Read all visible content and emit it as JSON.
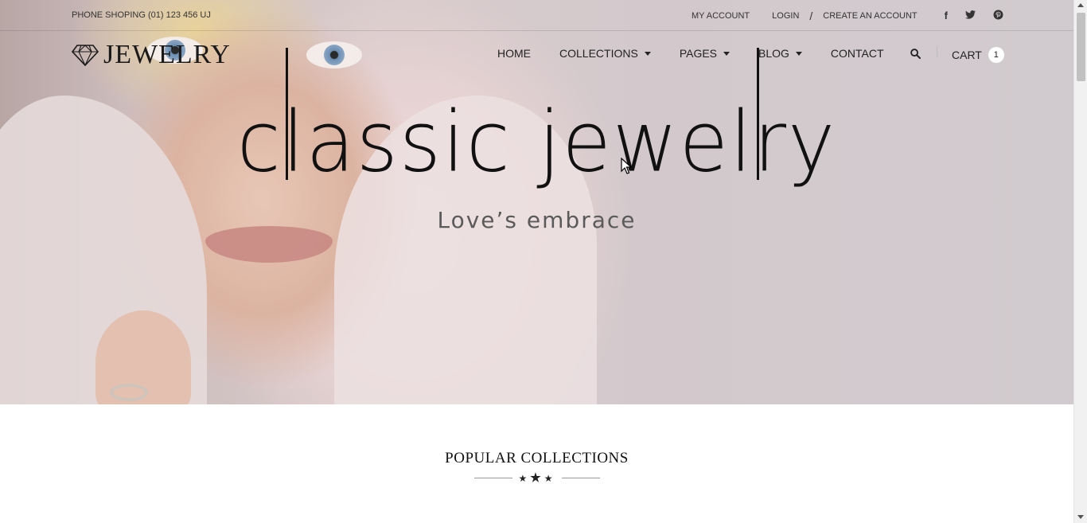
{
  "topbar": {
    "phone": "PHONE SHOPING (01) 123 456 UJ",
    "my_account": "MY ACCOUNT",
    "login": "LOGIN",
    "separator": "/",
    "create_account": "CREATE AN ACCOUNT",
    "social": [
      {
        "icon": "facebook-icon",
        "glyph": "f"
      },
      {
        "icon": "twitter-icon",
        "glyph": "t"
      },
      {
        "icon": "pinterest-icon",
        "glyph": "p"
      }
    ]
  },
  "logo": {
    "text": "JEWELRY",
    "icon": "diamond-icon"
  },
  "nav": {
    "items": [
      {
        "label": "HOME",
        "dropdown": false
      },
      {
        "label": "COLLECTIONS",
        "dropdown": true
      },
      {
        "label": "PAGES",
        "dropdown": true
      },
      {
        "label": "BLOG",
        "dropdown": true
      },
      {
        "label": "CONTACT",
        "dropdown": false
      }
    ],
    "search_icon": "search-icon",
    "cart_label": "CART",
    "cart_count": "1"
  },
  "hero": {
    "headline": "classic jewelry",
    "subhead": "Love’s embrace"
  },
  "section": {
    "title": "POPULAR COLLECTIONS"
  }
}
